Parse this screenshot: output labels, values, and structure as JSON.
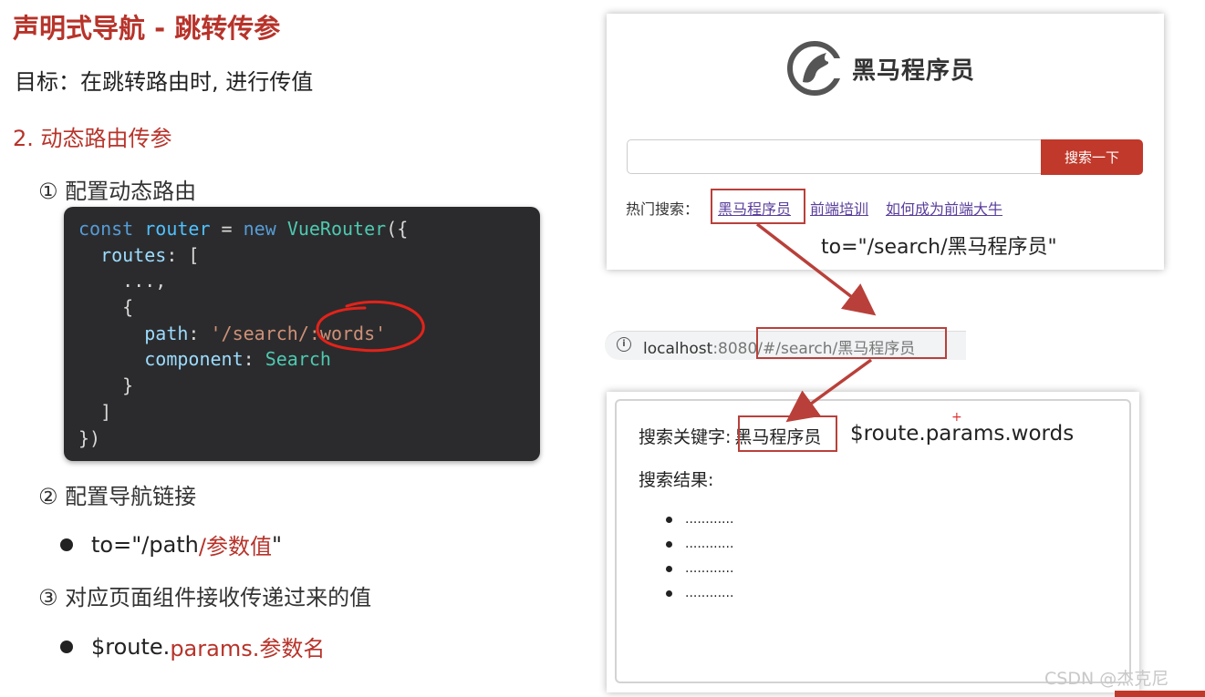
{
  "slide": {
    "title": "声明式导航 - 跳转传参",
    "goal": "目标：在跳转路由时, 进行传值",
    "section": "2.  动态路由传参",
    "step1": "① 配置动态路由",
    "step2": "② 配置导航链接",
    "bullet1_prefix": "to=\"/path",
    "bullet1_red": "/参数值",
    "bullet1_suffix": "\"",
    "step3": "③ 对应页面组件接收传递过来的值",
    "bullet2_prefix": "$route.",
    "bullet2_red": "params.参数名"
  },
  "code": {
    "l1_kw": "const",
    "l1_var": "router",
    "l1_eq": " = ",
    "l1_new": "new",
    "l1_cls": "VueRouter",
    "l1_end": "({",
    "l2_prop": "routes",
    "l2_end": ": [",
    "l3": "...,",
    "l4": "{",
    "l5_prop": "path",
    "l5_colon": ": ",
    "l5_str": "'/search/:words'",
    "l6_prop": "component",
    "l6_colon": ": ",
    "l6_val": "Search",
    "l7": "}",
    "l8": "]",
    "l9": "})"
  },
  "browser_top": {
    "logo_text": "黑马程序员",
    "search_button": "搜索一下",
    "hot_label": "热门搜索：",
    "hot_links": [
      "黑马程序员",
      "前端培训",
      "如何成为前端大牛"
    ],
    "to_annotation": "to=\"/search/黑马程序员\""
  },
  "urlbar": {
    "host": "localhost",
    "port_path": ":8080/#/search/黑马程序员"
  },
  "browser_bottom": {
    "keyword_label": "搜索关键字:",
    "keyword_value": "黑马程序员",
    "route_annotation": "$route.params.words",
    "result_label": "搜索结果:",
    "results": [
      "............",
      "............",
      "............",
      "............"
    ]
  },
  "watermark": "CSDN @杰克尼",
  "colors": {
    "accent_red": "#b7332a",
    "button_red": "#c0392b",
    "code_bg": "#2b2b2d",
    "link_purple": "#5a3e9b"
  }
}
